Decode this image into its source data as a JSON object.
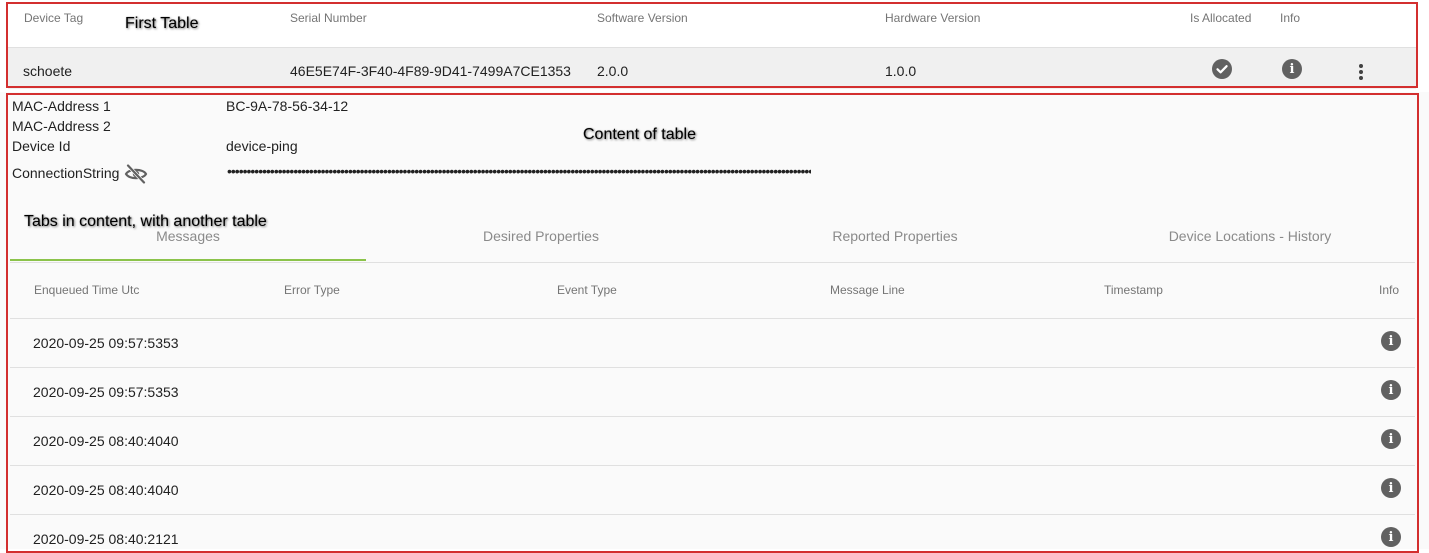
{
  "annotations": {
    "first_table": "First Table",
    "content_of_table": "Content of table",
    "tabs_in_content": "Tabs in content, with another table"
  },
  "device_table": {
    "headers": {
      "device_tag": "Device Tag",
      "serial_number": "Serial Number",
      "software_version": "Software Version",
      "hardware_version": "Hardware Version",
      "is_allocated": "Is Allocated",
      "info": "Info"
    },
    "row": {
      "device_tag": "schoete",
      "serial_number": "46E5E74F-3F40-4F89-9D41-7499A7CE1353",
      "software_version": "2.0.0",
      "hardware_version": "1.0.0",
      "is_allocated_icon": "check-circle-icon",
      "info_icon": "info-icon",
      "menu_icon": "more-vert-icon"
    }
  },
  "details": {
    "mac1_label": "MAC-Address 1",
    "mac1_value": "BC-9A-78-56-34-12",
    "mac2_label": "MAC-Address 2",
    "mac2_value": "",
    "device_id_label": "Device Id",
    "device_id_value": "device-ping",
    "connection_string_label": "ConnectionString",
    "connection_string_icon": "eye-off-icon",
    "connection_string_masked": "•••••••••••••••••••••••••••••••••••••••••••••••••••••••••••••••••••••••••••••••••••••••••••••••••••••••••••••••••••••••••••••••••••••••••••••••••••••••••••••••••••••••••••••••••••••••••••••••••••••••••••••••••••••••••••••••••••••••"
  },
  "tabs": [
    {
      "label": "Messages",
      "active": true
    },
    {
      "label": "Desired Properties",
      "active": false
    },
    {
      "label": "Reported Properties",
      "active": false
    },
    {
      "label": "Device Locations - History",
      "active": false
    }
  ],
  "messages_table": {
    "headers": {
      "enqueued_time": "Enqueued Time Utc",
      "error_type": "Error Type",
      "event_type": "Event Type",
      "message_line": "Message Line",
      "timestamp": "Timestamp",
      "info": "Info"
    },
    "rows": [
      {
        "enqueued_time": "2020-09-25 09:57:5353"
      },
      {
        "enqueued_time": "2020-09-25 09:57:5353"
      },
      {
        "enqueued_time": "2020-09-25 08:40:4040"
      },
      {
        "enqueued_time": "2020-09-25 08:40:4040"
      },
      {
        "enqueued_time": "2020-09-25 08:40:2121"
      }
    ]
  },
  "colors": {
    "annotation_border": "#d32f2f",
    "active_tab_underline": "#8bc34a",
    "icon_gray": "#616161"
  }
}
